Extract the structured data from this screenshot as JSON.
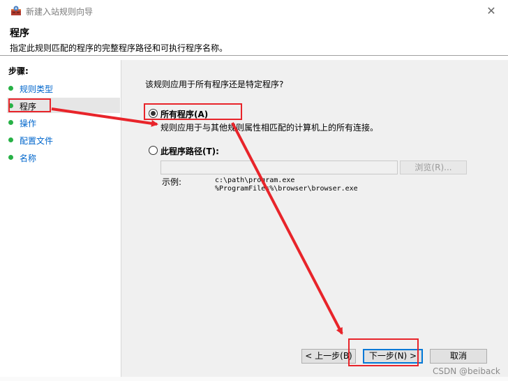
{
  "window": {
    "title": "新建入站规则向导",
    "close_glyph": "✕"
  },
  "header": {
    "title": "程序",
    "description": "指定此规则匹配的程序的完整程序路径和可执行程序名称。"
  },
  "sidebar": {
    "steps_label": "步骤:",
    "items": [
      {
        "label": "规则类型"
      },
      {
        "label": "程序"
      },
      {
        "label": "操作"
      },
      {
        "label": "配置文件"
      },
      {
        "label": "名称"
      }
    ]
  },
  "main": {
    "question": "该规则应用于所有程序还是特定程序?",
    "option_all": {
      "label": "所有程序(A)",
      "description": "规则应用于与其他规则属性相匹配的计算机上的所有连接。",
      "selected": true
    },
    "option_path": {
      "label": "此程序路径(T):",
      "selected": false,
      "value": ""
    },
    "browse_label": "浏览(R)...",
    "example_label": "示例:",
    "example_paths": [
      "c:\\path\\program.exe",
      "%ProgramFiles%\\browser\\browser.exe"
    ]
  },
  "buttons": {
    "back": "< 上一步(B)",
    "next": "下一步(N) >",
    "cancel": "取消"
  },
  "watermark": "CSDN @beiback",
  "colors": {
    "accent": "#0078d7",
    "annotation": "#e8242a",
    "step_dot": "#27b146",
    "link": "#0066cc"
  },
  "icons": {
    "app": "firewall-shield-icon",
    "step_bullet": "green-dot-icon"
  }
}
